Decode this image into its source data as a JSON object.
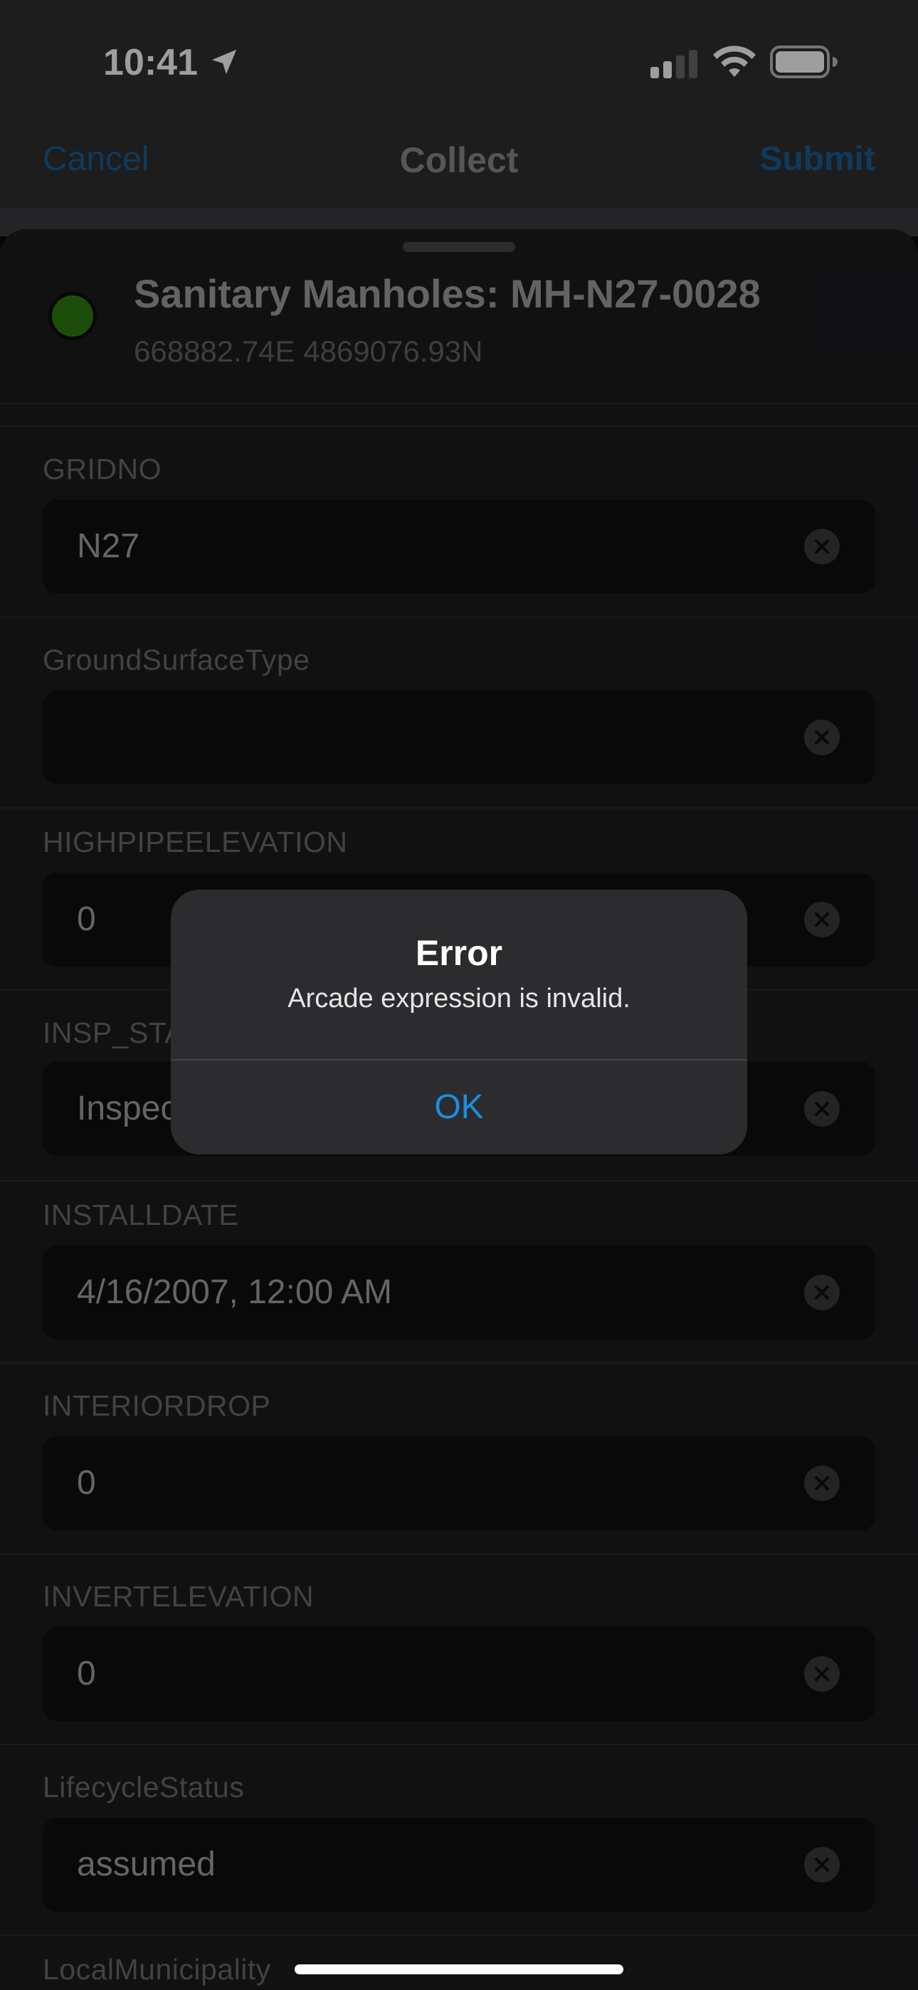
{
  "status_bar": {
    "time": "10:41"
  },
  "nav": {
    "cancel": "Cancel",
    "title": "Collect",
    "submit": "Submit"
  },
  "feature": {
    "title": "Sanitary Manholes: MH-N27-0028",
    "coordinates": "668882.74E 4869076.93N",
    "status_color": "#2f7d12"
  },
  "fields": [
    {
      "label": "GRIDNO",
      "value": "N27"
    },
    {
      "label": "GroundSurfaceType",
      "value": ""
    },
    {
      "label": "HIGHPIPEELEVATION",
      "value": "0"
    },
    {
      "label": "INSP_STATUS",
      "value": "Inspected"
    },
    {
      "label": "INSTALLDATE",
      "value": "4/16/2007, 12:00 AM"
    },
    {
      "label": "INTERIORDROP",
      "value": "0"
    },
    {
      "label": "INVERTELEVATION",
      "value": "0"
    },
    {
      "label": "LifecycleStatus",
      "value": "assumed"
    },
    {
      "label": "LocalMunicipality",
      "value": ""
    }
  ],
  "alert": {
    "title": "Error",
    "message": "Arcade expression is invalid.",
    "ok": "OK"
  },
  "colors": {
    "accent": "#1a8fe3",
    "nav_link_dimmed": "#1b5e93"
  }
}
